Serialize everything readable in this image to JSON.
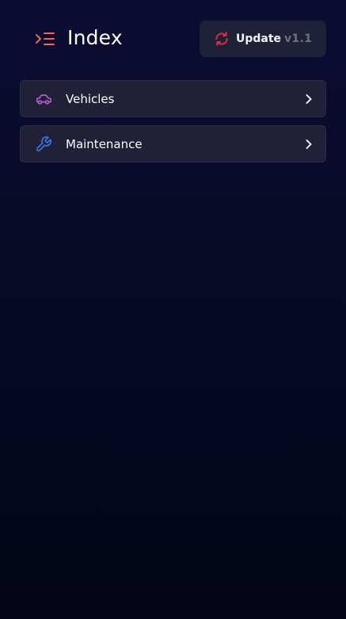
{
  "header": {
    "title": "Index",
    "icon": "indent-list-icon",
    "accent_color": "#f0645f"
  },
  "update_button": {
    "label": "Update",
    "version": "v1.1",
    "icon": "refresh-icon",
    "icon_color": "#e02a4a"
  },
  "menu": {
    "items": [
      {
        "label": "Vehicles",
        "icon": "car-icon",
        "icon_color": "#c85ad7"
      },
      {
        "label": "Maintenance",
        "icon": "wrench-icon",
        "icon_color": "#3a7bf0"
      }
    ]
  }
}
